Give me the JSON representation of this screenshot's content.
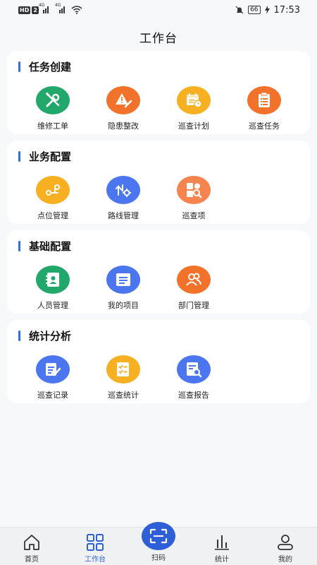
{
  "status_bar": {
    "hd_label": "HD",
    "sim_label": "2",
    "network_1": "4G",
    "network_2": "4G",
    "battery": "66",
    "time": "17:53"
  },
  "header": {
    "title": "工作台"
  },
  "sections": [
    {
      "title": "任务创建",
      "items": [
        {
          "label": "维修工单",
          "icon": "wrench-screwdriver-icon",
          "color": "#22a86a"
        },
        {
          "label": "隐患整改",
          "icon": "warning-pen-icon",
          "color": "#f2722b"
        },
        {
          "label": "巡查计划",
          "icon": "calendar-clock-icon",
          "color": "#f6b021"
        },
        {
          "label": "巡查任务",
          "icon": "clipboard-list-icon",
          "color": "#f2722b"
        }
      ]
    },
    {
      "title": "业务配置",
      "items": [
        {
          "label": "点位管理",
          "icon": "node-link-icon",
          "color": "#f6b021"
        },
        {
          "label": "路线管理",
          "icon": "route-gear-icon",
          "color": "#4b76f0"
        },
        {
          "label": "巡查项",
          "icon": "shapes-search-icon",
          "color": "#f7834e"
        }
      ]
    },
    {
      "title": "基础配置",
      "items": [
        {
          "label": "人员管理",
          "icon": "contact-book-icon",
          "color": "#22a86a"
        },
        {
          "label": "我的项目",
          "icon": "list-card-icon",
          "color": "#4b76f0"
        },
        {
          "label": "部门管理",
          "icon": "group-icon",
          "color": "#f2722b"
        }
      ]
    },
    {
      "title": "统计分析",
      "items": [
        {
          "label": "巡查记录",
          "icon": "document-pen-icon",
          "color": "#4b76f0"
        },
        {
          "label": "巡查统计",
          "icon": "checklist-icon",
          "color": "#f6b021"
        },
        {
          "label": "巡查报告",
          "icon": "report-search-icon",
          "color": "#4b76f0"
        }
      ]
    }
  ],
  "tabbar": {
    "tabs": [
      {
        "label": "首页",
        "icon": "home-icon"
      },
      {
        "label": "工作台",
        "icon": "grid-icon",
        "active": true
      },
      {
        "label": "扫码",
        "icon": "scan-icon"
      },
      {
        "label": "统计",
        "icon": "bar-chart-icon"
      },
      {
        "label": "我的",
        "icon": "user-icon"
      }
    ],
    "active_color": "#2f62d8"
  }
}
